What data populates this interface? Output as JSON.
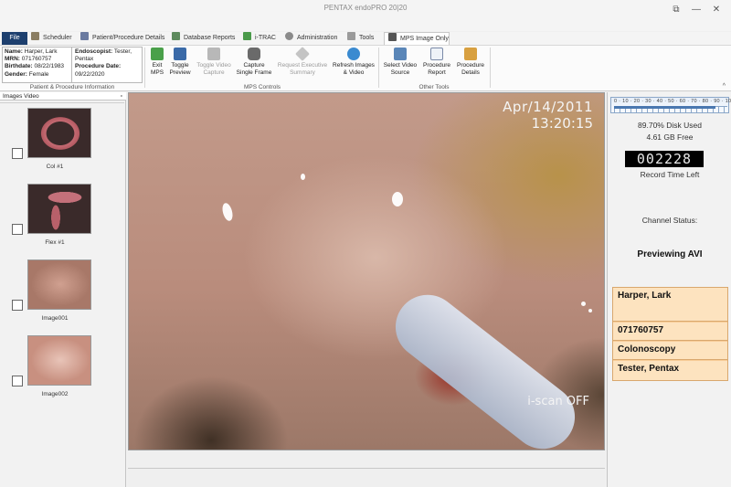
{
  "window": {
    "title": "PENTAX endoPRO 20|20",
    "controls": {
      "restore": "⧉",
      "minimize": "—",
      "maximize": "□",
      "close": "✕"
    }
  },
  "tabs": [
    {
      "label": "File",
      "icon": "file-menu"
    },
    {
      "label": "Scheduler",
      "icon": "calendar-icon"
    },
    {
      "label": "Patient/Procedure Details",
      "icon": "patient-icon"
    },
    {
      "label": "Database Reports",
      "icon": "report-icon"
    },
    {
      "label": "i-TRAC",
      "icon": "itrac-icon"
    },
    {
      "label": "Administration",
      "icon": "gear-icon"
    },
    {
      "label": "Tools",
      "icon": "tools-icon"
    },
    {
      "label": "MPS Image Only",
      "icon": "camera-icon",
      "active": true
    }
  ],
  "patient": {
    "name_label": "Name:",
    "name": "Harper, Lark",
    "mrn_label": "MRN:",
    "mrn": "071760757",
    "birthdate_label": "Birthdate:",
    "birthdate": "08/22/1983",
    "gender_label": "Gender:",
    "gender": "Female",
    "endoscopist_label": "Endoscopist:",
    "endoscopist_first": "Tester,",
    "endoscopist_second": "Pentax",
    "procedure_date_label": "Procedure Date:",
    "procedure_date": "09/22/2020",
    "caption": "Patient & Procedure Information"
  },
  "ribbon": {
    "mps_buttons": [
      {
        "line1": "Exit",
        "line2": "MPS",
        "icon": "exit-icon"
      },
      {
        "line1": "Toggle",
        "line2": "Preview",
        "icon": "monitor-icon"
      },
      {
        "line1": "Toggle Video",
        "line2": "Capture",
        "icon": "video-camera-icon",
        "disabled": true
      },
      {
        "line1": "Capture",
        "line2": "Single Frame",
        "icon": "camera-icon"
      },
      {
        "line1": "Request Executive",
        "line2": "Summary",
        "icon": "summary-icon",
        "disabled": true
      },
      {
        "line1": "Refresh Images",
        "line2": "& Video",
        "icon": "refresh-icon"
      }
    ],
    "mps_caption": "MPS Controls",
    "other_buttons": [
      {
        "line1": "Select Video",
        "line2": "Source",
        "icon": "video-source-icon"
      },
      {
        "line1": "Procedure",
        "line2": "Report",
        "icon": "report-doc-icon"
      },
      {
        "line1": "Procedure",
        "line2": "Details",
        "icon": "details-icon"
      }
    ],
    "other_caption": "Other Tools",
    "collapse": "^"
  },
  "left_panel": {
    "header_images": "Images",
    "header_video": "Video",
    "pin": "▫",
    "thumbnails": [
      {
        "label": "Col #1"
      },
      {
        "label": "Flex #1"
      },
      {
        "label": "Image001"
      },
      {
        "label": "Image002"
      }
    ]
  },
  "video": {
    "date": "Apr/14/2011",
    "time": "13:20:15",
    "mode": "i-scan OFF"
  },
  "right_panel": {
    "gauge_ticks": "0 · 10 · 20 · 30 · 40 · 50 · 60 · 70 · 80 · 90 · 100",
    "disk_used_fraction": 0.897,
    "disk_used": "89.70%  Disk Used",
    "disk_free": "4.61 GB  Free",
    "record_counter": "002228",
    "record_time_left": "Record Time Left",
    "channel_status_label": "Channel Status:",
    "preview_status": "Previewing AVI",
    "info": {
      "patient_name": "Harper, Lark",
      "mrn": "071760757",
      "procedure": "Colonoscopy",
      "physician": "Tester, Pentax"
    }
  }
}
